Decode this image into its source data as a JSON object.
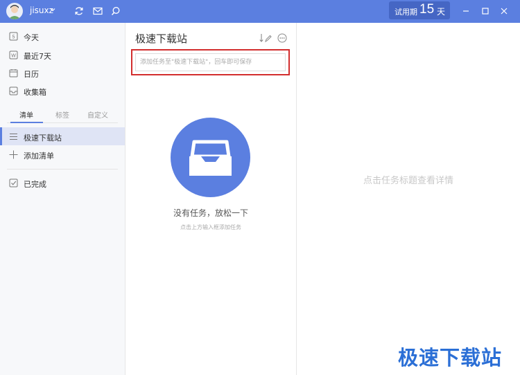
{
  "header": {
    "username": "jisuxz",
    "trial_label": "试用期",
    "trial_days": "15",
    "trial_unit": "天"
  },
  "sidebar": {
    "smart_lists": [
      {
        "label": "今天",
        "icon": "calendar-today-icon"
      },
      {
        "label": "最近7天",
        "icon": "calendar-week-icon"
      },
      {
        "label": "日历",
        "icon": "calendar-icon"
      },
      {
        "label": "收集箱",
        "icon": "inbox-icon"
      }
    ],
    "tabs": [
      "清单",
      "标签",
      "自定义"
    ],
    "active_tab": "清单",
    "lists": [
      {
        "label": "极速下载站",
        "icon": "list-icon",
        "active": true
      }
    ],
    "add_list_label": "添加清单",
    "completed_label": "已完成"
  },
  "task_list": {
    "title": "极速下载站",
    "input_placeholder": "添加任务至\"极速下载站\"，回车即可保存",
    "empty_title": "没有任务，放松一下",
    "empty_subtitle": "点击上方输入框添加任务"
  },
  "detail": {
    "hint": "点击任务标题查看详情"
  },
  "watermark": "极速下载站",
  "colors": {
    "accent": "#5b7fe0",
    "highlight_border": "#d22d2d",
    "watermark": "#2b6fd6"
  }
}
